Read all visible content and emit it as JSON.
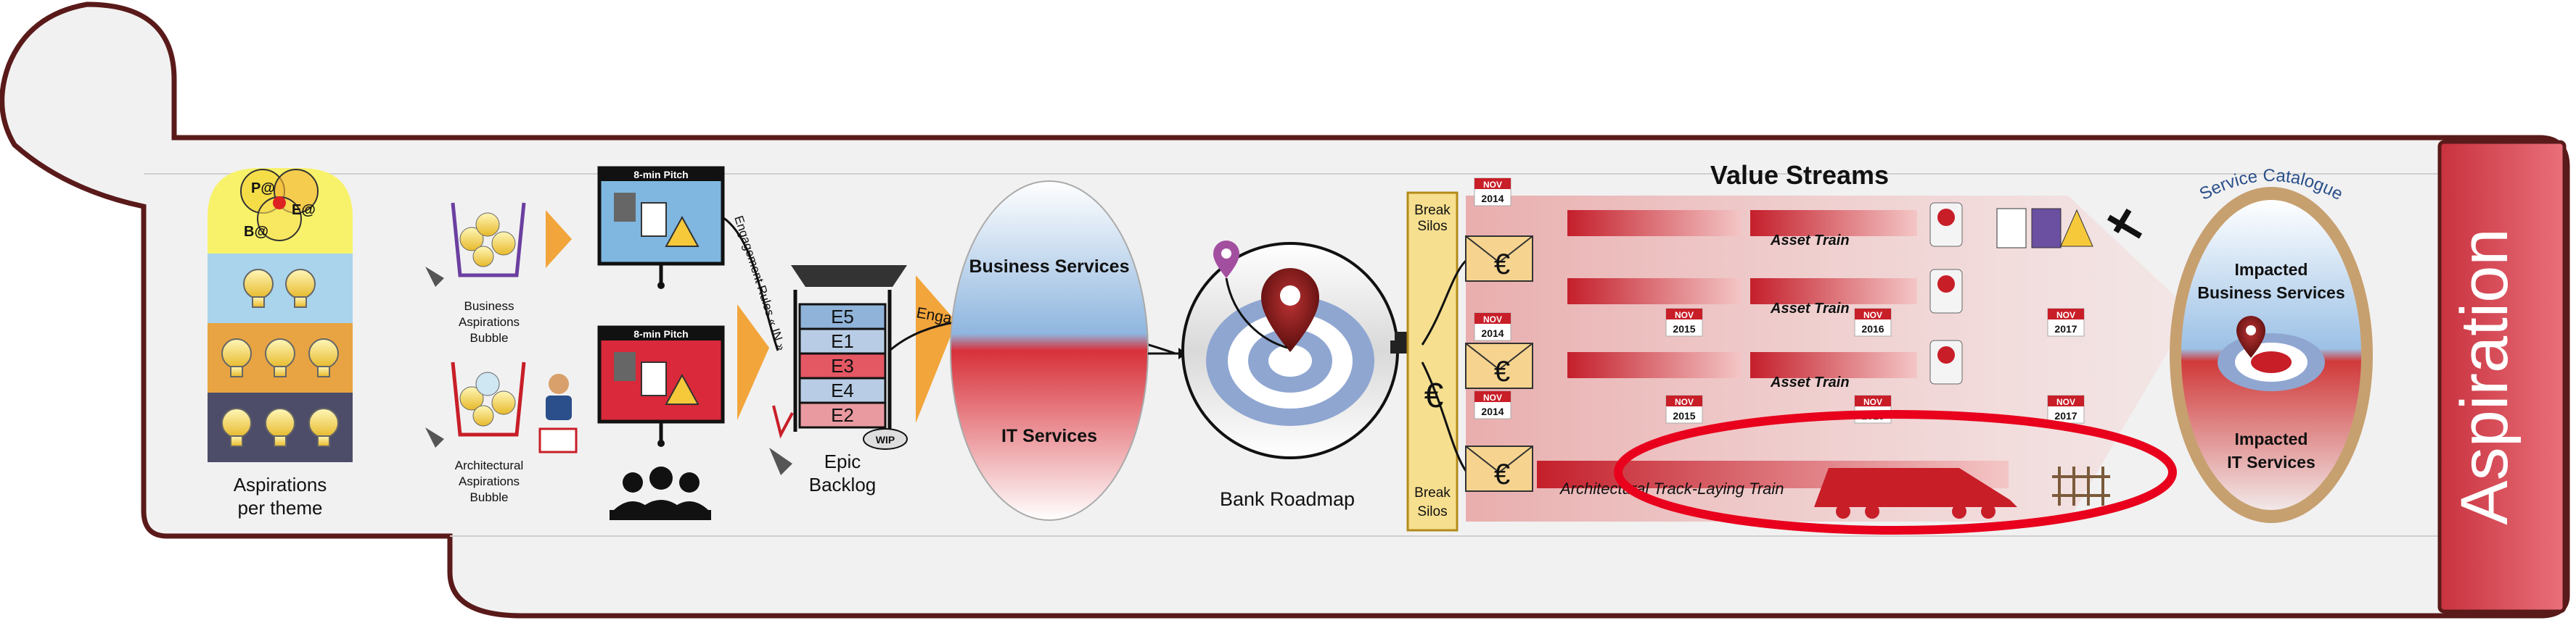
{
  "aspirations_panel": {
    "label_line1": "Aspirations",
    "label_line2": "per theme",
    "venn_labels": [
      "P@",
      "E@",
      "B@"
    ]
  },
  "bubbles": {
    "business_line1": "Business",
    "business_line2": "Aspirations",
    "business_line3": "Bubble",
    "architectural_line1": "Architectural",
    "architectural_line2": "Aspirations",
    "architectural_line3": "Bubble"
  },
  "pitch": {
    "top_title": "8-min Pitch",
    "bottom_title": "8-min Pitch"
  },
  "engagement": {
    "rules_in": "Engagement Rules « IN »",
    "rules_out": "Engagement Rules « OUT »"
  },
  "backlog": {
    "items": [
      "E5",
      "E1",
      "E3",
      "E4",
      "E2"
    ],
    "wip": "WIP",
    "label_line1": "Epic",
    "label_line2": "Backlog"
  },
  "services_oval": {
    "business": "Business Services",
    "it": "IT Services"
  },
  "roadmap": {
    "label": "Bank Roadmap"
  },
  "silos": {
    "top_line1": "Break",
    "top_line2": "Silos",
    "bottom_line1": "Break",
    "bottom_line2": "Silos"
  },
  "value_streams": {
    "title": "Value Streams",
    "rows": [
      {
        "train": "Asset Train",
        "month": "NOV",
        "year": "2014",
        "dates": []
      },
      {
        "train": "Asset Train",
        "month": "NOV",
        "year": "2014",
        "dates": [
          [
            "NOV",
            "2015"
          ],
          [
            "NOV",
            "2016"
          ],
          [
            "NOV",
            "2017"
          ]
        ]
      },
      {
        "train": "Asset Train",
        "month": "NOV",
        "year": "2014",
        "dates": [
          [
            "NOV",
            "2015"
          ],
          [
            "NOV",
            "2016"
          ],
          [
            "NOV",
            "2017"
          ]
        ]
      }
    ],
    "architectural_train": "Architectural Track-Laying Train"
  },
  "service_catalogue": {
    "title": "Service Catalogue",
    "business_line1": "Impacted",
    "business_line2": "Business Services",
    "it_line1": "Impacted",
    "it_line2": "IT Services"
  },
  "side_tab": {
    "label": "Aspiration"
  },
  "colors": {
    "outline": "#5a1a1a",
    "panel_bg": "#f1f1f1",
    "tab_red": "#dc4f5a",
    "orange": "#f2a53b",
    "highlight_red": "#e8001c",
    "dark_red": "#7a0f0f"
  }
}
